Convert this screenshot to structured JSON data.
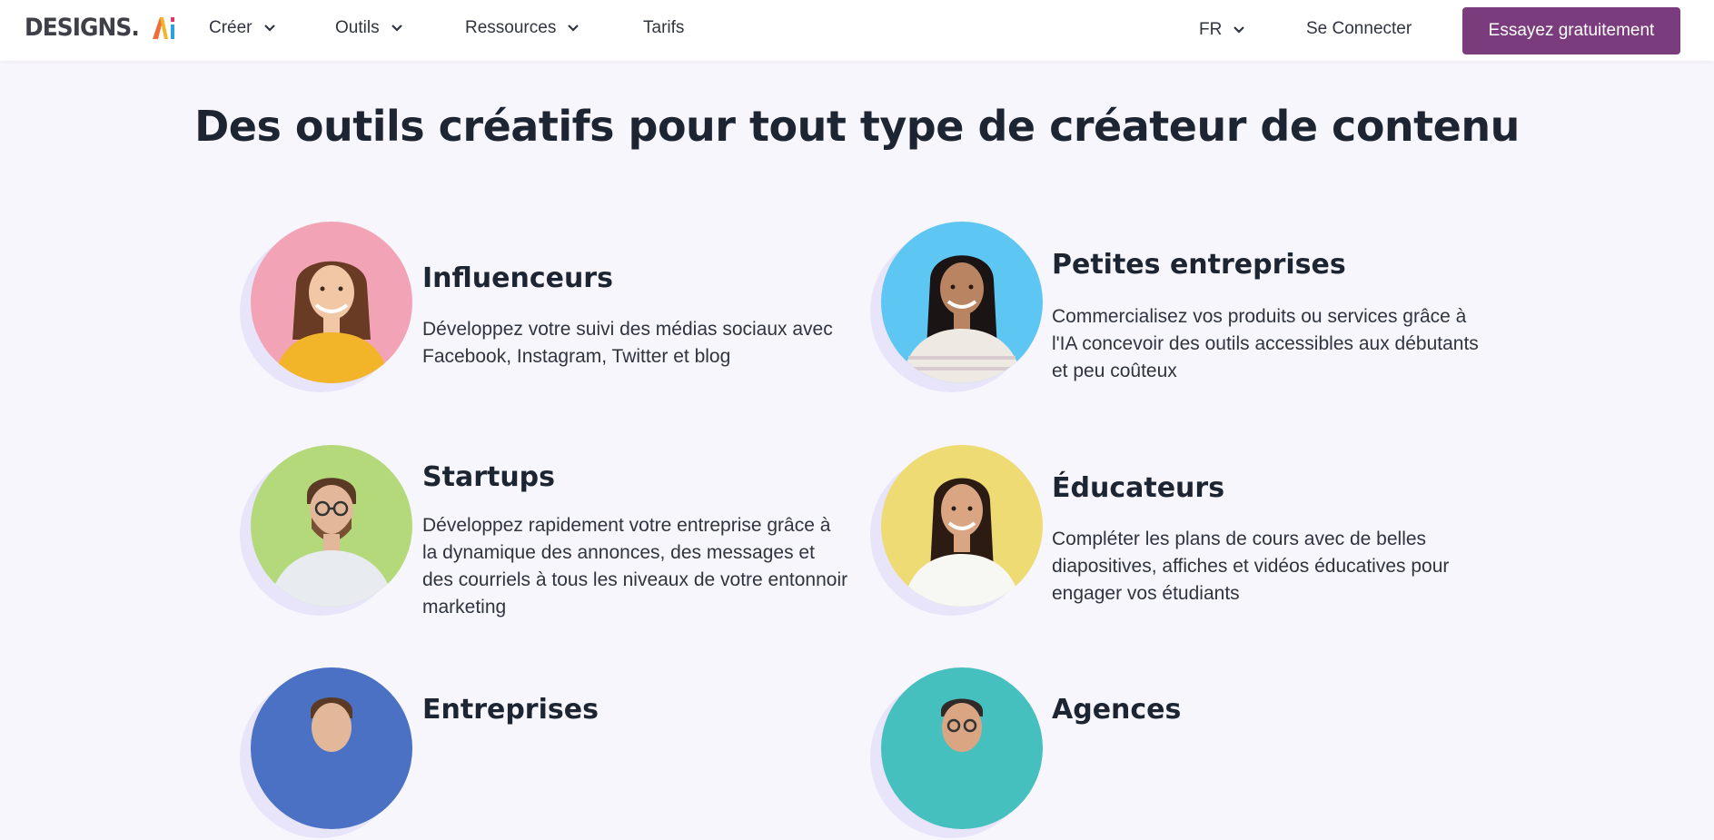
{
  "header": {
    "logo_text": "DESIGNS.",
    "logo_ai": "AI",
    "nav": [
      {
        "label": "Créer"
      },
      {
        "label": "Outils"
      },
      {
        "label": "Ressources"
      },
      {
        "label": "Tarifs"
      }
    ],
    "language": "FR",
    "login_label": "Se Connecter",
    "cta_label": "Essayez gratuitement"
  },
  "main": {
    "heading": "Des outils créatifs pour tout type de créateur de contenu",
    "cards": [
      {
        "title": "Influenceurs",
        "description": "Développez votre suivi des médias sociaux avec Facebook, Instagram, Twitter et blog",
        "bg_color": "#f3a3b6",
        "shirt_color": "#f2b428",
        "hair_color": "#6a3b24"
      },
      {
        "title": "Petites entreprises",
        "description": "Commercialisez vos produits ou services grâce à l'IA concevoir des outils accessibles aux débutants et peu coûteux",
        "bg_color": "#5ec6f2",
        "shirt_color": "#efe9e4",
        "hair_color": "#1a1414"
      },
      {
        "title": "Startups",
        "description": "Développez rapidement votre entreprise grâce à la dynamique des annonces, des messages et des courriels à tous les niveaux de votre entonnoir marketing",
        "bg_color": "#b4d97a",
        "shirt_color": "#e8ebf0",
        "hair_color": "#5a3a24"
      },
      {
        "title": "Éducateurs",
        "description": "Compléter les plans de cours avec de belles diapositives, affiches et vidéos éducatives pour engager vos étudiants",
        "bg_color": "#efdb74",
        "shirt_color": "#f7f7f4",
        "hair_color": "#2b1b12"
      },
      {
        "title": "Entreprises",
        "description": "",
        "bg_color": "#4a71c4",
        "shirt_color": "#ffffff",
        "hair_color": "#5a3a24"
      },
      {
        "title": "Agences",
        "description": "",
        "bg_color": "#46bfbf",
        "shirt_color": "#ffffff",
        "hair_color": "#2f2a28"
      }
    ]
  },
  "colors": {
    "accent": "#7b3c7e",
    "page_bg": "#f7f6fc",
    "avatar_shadow": "#e8e4fa"
  }
}
